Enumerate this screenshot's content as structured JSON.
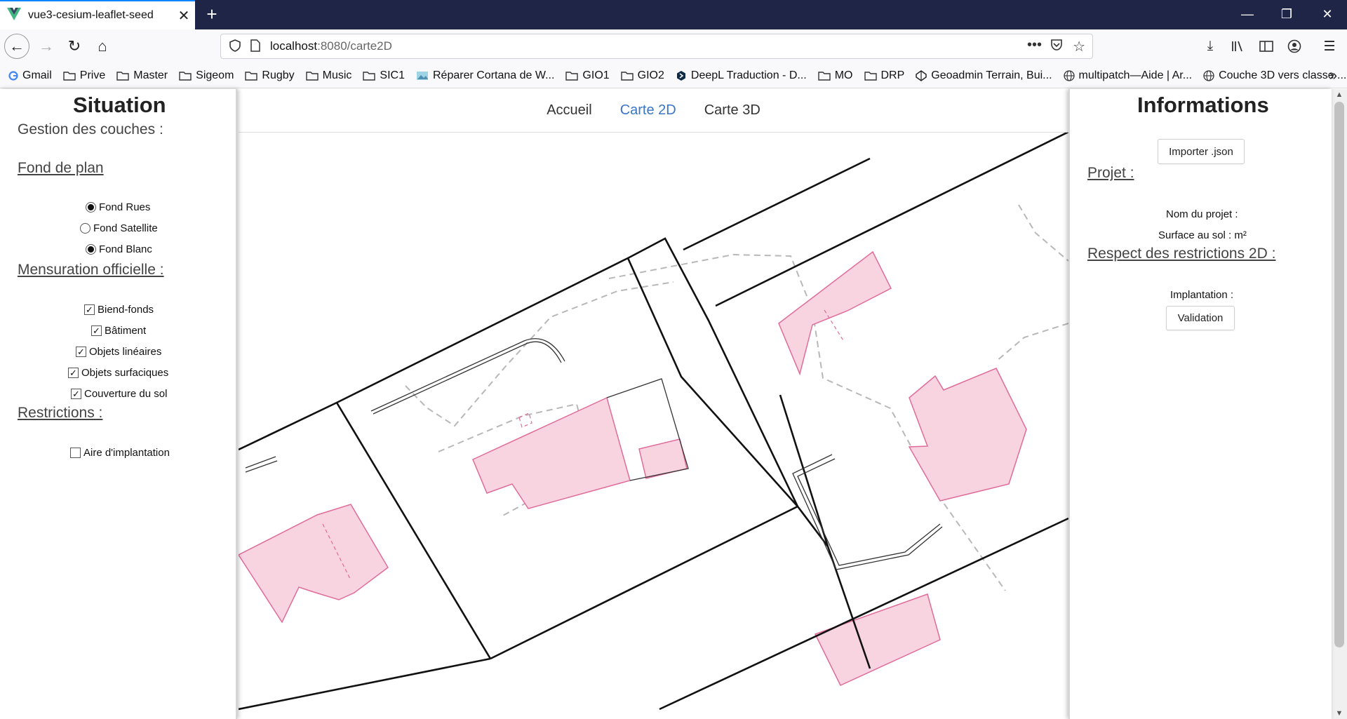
{
  "browser": {
    "tab_title": "vue3-cesium-leaflet-seed",
    "url_host": "localhost",
    "url_path": ":8080/carte2D",
    "bookmarks": [
      "Gmail",
      "Prive",
      "Master",
      "Sigeom",
      "Rugby",
      "Music",
      "SIC1",
      "Réparer Cortana de W...",
      "GIO1",
      "GIO2",
      "DeepL Traduction - D...",
      "MO",
      "DRP",
      "Geoadmin Terrain, Bui...",
      "multipatch—Aide | Ar...",
      "Couche 3D vers classe ..."
    ]
  },
  "left": {
    "title": "Situation",
    "layers_heading": "Gestion des couches :",
    "basemap_heading": "Fond de plan",
    "basemaps": [
      {
        "label": "Fond Rues",
        "checked": true
      },
      {
        "label": "Fond Satellite",
        "checked": false
      },
      {
        "label": "Fond Blanc",
        "checked": true
      }
    ],
    "mo_heading": "Mensuration officielle :",
    "mo_layers": [
      {
        "label": "Biend-fonds",
        "checked": true
      },
      {
        "label": "Bâtiment",
        "checked": true
      },
      {
        "label": "Objets linéaires",
        "checked": true
      },
      {
        "label": "Objets surfaciques",
        "checked": true
      },
      {
        "label": "Couverture du sol",
        "checked": true
      }
    ],
    "restrictions_heading": "Restrictions :",
    "restrictions": [
      {
        "label": "Aire d'implantation",
        "checked": false
      }
    ]
  },
  "nav": {
    "items": [
      {
        "label": "Accueil",
        "active": false
      },
      {
        "label": "Carte 2D",
        "active": true
      },
      {
        "label": "Carte 3D",
        "active": false
      }
    ]
  },
  "right": {
    "title": "Informations",
    "import_button": "Importer .json",
    "project_heading": "Projet :",
    "project_name_label": "Nom du projet :",
    "surface_label": "Surface au sol : m²",
    "restrictions_heading": "Respect des restrictions 2D :",
    "implantation_label": "Implantation :",
    "validation_button": "Validation"
  },
  "colors": {
    "building_fill": "#f8d3e0",
    "building_stroke": "#e06c99",
    "accent": "#3a76c3",
    "titlebar": "#1f2546"
  }
}
